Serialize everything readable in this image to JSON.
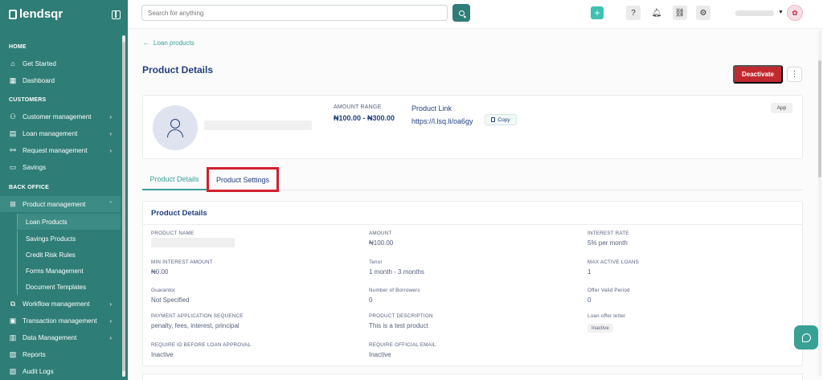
{
  "app": {
    "logo_text": "lendsqr"
  },
  "sidebar": {
    "sections": {
      "home": "HOME",
      "customers": "CUSTOMERS",
      "back_office": "BACK OFFICE"
    },
    "items": {
      "get_started": "Get Started",
      "dashboard": "Dashboard",
      "customer_management": "Customer management",
      "loan_management": "Loan management",
      "request_management": "Request management",
      "savings": "Savings",
      "product_management": "Product management",
      "workflow_management": "Workflow management",
      "transaction_management": "Transaction management",
      "data_management": "Data Management",
      "reports": "Reports",
      "audit_logs": "Audit Logs"
    },
    "sub_items": {
      "loan_products": "Loan Products",
      "savings_products": "Savings Products",
      "credit_risk_rules": "Credit Risk Rules",
      "forms_management": "Forms Management",
      "document_templates": "Document Templates"
    }
  },
  "topbar": {
    "search_placeholder": "Search for anything"
  },
  "page": {
    "back_link": "Loan products",
    "title": "Product Details",
    "deactivate_label": "Deactivate",
    "more_label": "⋮"
  },
  "summary": {
    "amount_range_label": "AMOUNT RANGE",
    "amount_range_value": "₦100.00 - ₦300.00",
    "product_link_label": "Product Link",
    "product_link_value": "https://l.lsq.li/oa6gy",
    "copy_label": "Copy",
    "channel_badge": "App"
  },
  "tabs": {
    "details": "Product Details",
    "settings": "Product Settings"
  },
  "details": {
    "heading": "Product Details",
    "fields": {
      "product_name": {
        "label": "PRODUCT NAME"
      },
      "amount": {
        "label": "AMOUNT",
        "value": "₦100.00"
      },
      "interest_rate": {
        "label": "INTEREST RATE",
        "value": "5% per month"
      },
      "min_interest": {
        "label": "MIN INTEREST AMOUNT",
        "value": "₦0.00"
      },
      "tenor": {
        "label": "Tenor",
        "value": "1 month - 3 months"
      },
      "max_active_loans": {
        "label": "MAX ACTIVE LOANS",
        "value": "1"
      },
      "guarantor": {
        "label": "Guarantor",
        "value": "Not Specified"
      },
      "borrowers": {
        "label": "Number of Borrowers",
        "value": "0"
      },
      "offer_valid": {
        "label": "Offer Valid Period",
        "value": "0"
      },
      "payment_sequence": {
        "label": "PAYMENT APPLICATION SEQUENCE",
        "value": "penalty, fees, interest, principal"
      },
      "description": {
        "label": "PRODUCT DESCRIPTION",
        "value": "This is a test product"
      },
      "loan_offer_letter": {
        "label": "Loan offer letter",
        "value": "Inactive"
      },
      "require_id": {
        "label": "REQUIRE ID BEFORE LOAN APPROVAL",
        "value": "Inactive"
      },
      "require_email": {
        "label": "REQUIRE OFFICIAL EMAIL",
        "value": "Inactive"
      }
    }
  },
  "colors": {
    "sidebar": "#2e7d76",
    "accent": "#39a096",
    "danger": "#c2292f",
    "highlight": "#d3202f",
    "text": "#213f7d"
  }
}
